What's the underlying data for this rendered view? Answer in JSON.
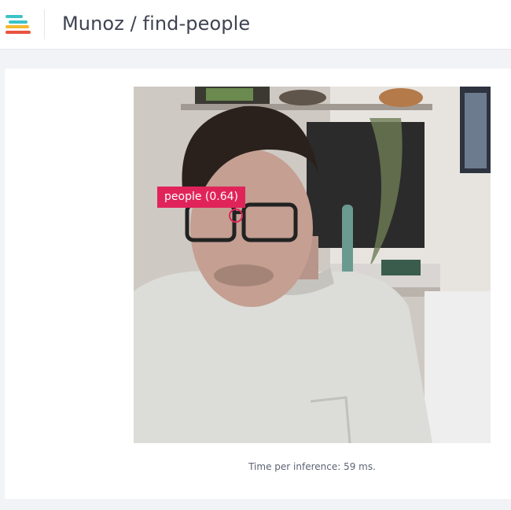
{
  "header": {
    "title": "Munoz / find-people",
    "logo_colors": [
      "#3cc3c8",
      "#f5b82e",
      "#e8533f"
    ]
  },
  "viewer": {
    "image_description_icon": "webcam-frame",
    "detection": {
      "label": "people (0.64)",
      "color": "#e0245a"
    },
    "inference_text": "Time per inference: 59 ms."
  }
}
